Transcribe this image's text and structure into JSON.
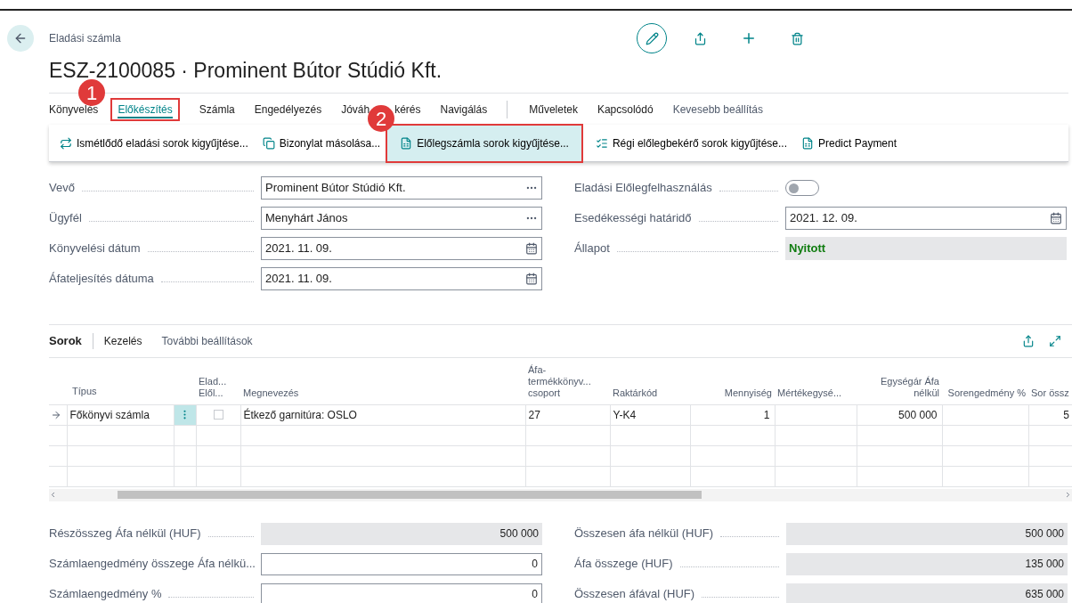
{
  "breadcrumb": "Eladási számla",
  "title": "ESZ-2100085 · Prominent Bútor Stúdió Kft.",
  "tabs": [
    {
      "label": "Könyvelés",
      "selected": false,
      "kind": "main"
    },
    {
      "label": "Előkészítés",
      "selected": true,
      "kind": "main"
    },
    {
      "label": "Számla",
      "selected": false,
      "kind": "main"
    },
    {
      "label": "Engedélyezés",
      "selected": false,
      "kind": "main"
    },
    {
      "label_parts": [
        "Jóváh",
        "kérés"
      ],
      "selected": false,
      "kind": "main"
    },
    {
      "label": "Navigálás",
      "selected": false,
      "kind": "main"
    },
    {
      "label": "Műveletek",
      "selected": false,
      "kind": "more"
    },
    {
      "label": "Kapcsolódó",
      "selected": false,
      "kind": "more"
    },
    {
      "label": "Kevesebb beállítás",
      "selected": false,
      "kind": "toggle"
    }
  ],
  "actions": [
    {
      "label": "Ismétlődő eladási sorok kigyűjtése...",
      "selected": false
    },
    {
      "label": "Bizonylat másolása...",
      "selected": false
    },
    {
      "label": "Előlegszámla sorok kigyűjtése...",
      "selected": true
    },
    {
      "label": "Régi előlegbekérő sorok kigyűjtése...",
      "selected": false
    },
    {
      "label": "Predict Payment",
      "selected": false
    }
  ],
  "callouts": [
    "1",
    "2"
  ],
  "fields_left": [
    {
      "label": "Vevő",
      "value": "Prominent Bútor Stúdió Kft.",
      "kind": "lookup"
    },
    {
      "label": "Ügyfél",
      "value": "Menyhárt János",
      "kind": "lookup"
    },
    {
      "label": "Könyvelési dátum",
      "value": "2021. 11. 09.",
      "kind": "date"
    },
    {
      "label": "Áfateljesítés dátuma",
      "value": "2021. 11. 09.",
      "kind": "date"
    }
  ],
  "fields_right": [
    {
      "label": "Eladási Előlegfelhasználás",
      "kind": "toggle",
      "on": false
    },
    {
      "label": "Esedékességi határidő",
      "value": "2021. 12. 09.",
      "kind": "date"
    },
    {
      "label": "Állapot",
      "value": "Nyitott",
      "kind": "status"
    }
  ],
  "lines": {
    "title": "Sorok",
    "menu": [
      "Kezelés",
      "További beállítások"
    ],
    "columns": [
      "Típus",
      "Elad... Elől...",
      "Megnevezés",
      "Áfa-termékkönyv... csoport",
      "Raktárkód",
      "Mennyiség",
      "Mértékegysé...",
      "Egységár Áfa nélkül",
      "Sorengedmény %",
      "Sor össz"
    ],
    "rows": [
      {
        "current": true,
        "type": "Főkönyvi számla",
        "checked": false,
        "description": "Étkező garnitúra: OSLO",
        "vat_group": "27",
        "location": "Y-K4",
        "quantity": "1",
        "unit": "",
        "unit_price": "500 000",
        "discount": "",
        "line_amount": "5"
      }
    ]
  },
  "totals_left": [
    {
      "label": "Részösszeg Áfa nélkül (HUF)",
      "value": "500 000",
      "editable": false
    },
    {
      "label": "Számlaengedmény összege Áfa nélkü...",
      "value": "0",
      "editable": true
    },
    {
      "label": "Számlaengedmény %",
      "value": "0",
      "editable": true
    }
  ],
  "totals_right": [
    {
      "label": "Összesen áfa nélkül (HUF)",
      "value": "500 000",
      "editable": false
    },
    {
      "label": "Áfa összege (HUF)",
      "value": "135 000",
      "editable": false
    },
    {
      "label": "Összesen áfával (HUF)",
      "value": "635 000",
      "editable": false
    }
  ]
}
